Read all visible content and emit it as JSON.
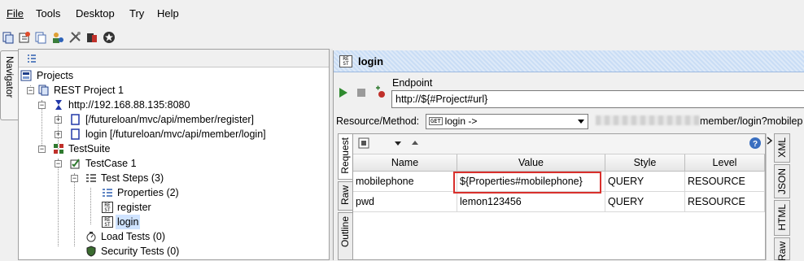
{
  "menu": [
    "File",
    "Tools",
    "Desktop",
    "Try",
    "Help"
  ],
  "navigator_tab": "Navigator",
  "tree": {
    "projects": "Projects",
    "project": "REST Project 1",
    "service": "http://192.168.88.135:8080",
    "resource_register": "[/futureloan/mvc/api/member/register]",
    "resource_login": "login [/futureloan/mvc/api/member/login]",
    "testsuite": "TestSuite",
    "testcase": "TestCase 1",
    "teststeps": "Test Steps (3)",
    "step_properties": "Properties (2)",
    "step_register": "register",
    "step_login": "login",
    "loadtests": "Load Tests (0)",
    "securitytests": "Security Tests (0)"
  },
  "editor": {
    "title": "login",
    "endpoint_label": "Endpoint",
    "endpoint_value": "http://${#Project#url}",
    "resource_method_label": "Resource/Method:",
    "resource_method_value": "login ->",
    "resource_method_badge": "GET",
    "resource_path_suffix": "member/login?mobilep",
    "side_tabs": [
      "Request",
      "Raw",
      "Outline"
    ],
    "right_tabs": [
      "XML",
      "JSON",
      "HTML",
      "Raw"
    ],
    "columns": [
      "Name",
      "Value",
      "Style",
      "Level"
    ],
    "rows": [
      {
        "name": "mobilephone",
        "value": "${Properties#mobilephone}",
        "style": "QUERY",
        "level": "RESOURCE"
      },
      {
        "name": "pwd",
        "value": "lemon123456",
        "style": "QUERY",
        "level": "RESOURCE"
      }
    ]
  },
  "colors": {
    "highlight": "#d9302c",
    "selection": "#cfe3ff",
    "titlebar": "#c9ddf5"
  }
}
